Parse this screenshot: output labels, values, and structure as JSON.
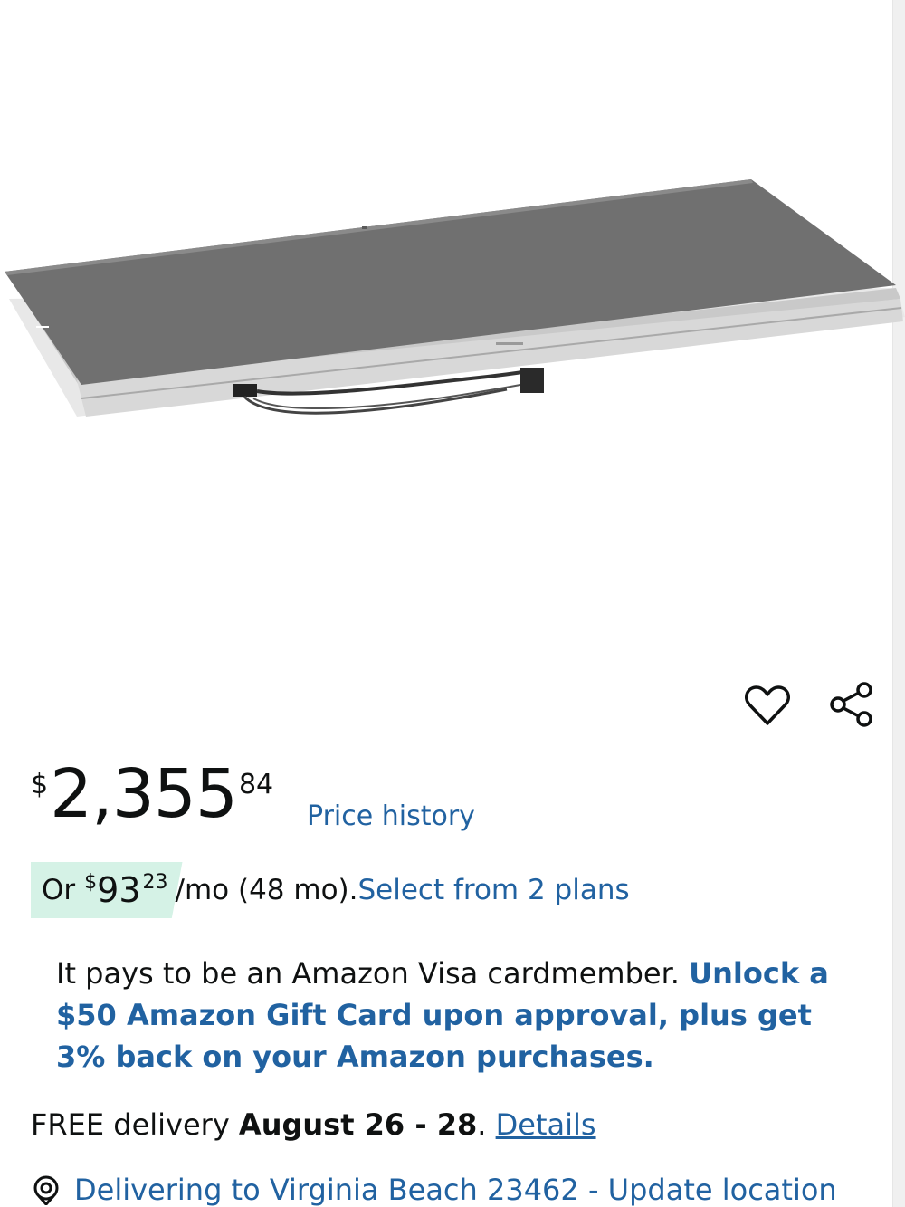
{
  "product": {
    "image_alt": "solar panel"
  },
  "actions": {
    "wishlist_icon": "heart-icon",
    "share_icon": "share-icon"
  },
  "price": {
    "symbol": "$",
    "whole": "2,355",
    "fraction": "84",
    "history_label": "Price history"
  },
  "installment": {
    "prefix": "Or",
    "symbol": "$",
    "whole": "93",
    "fraction": "23",
    "suffix": "/mo (48 mo).",
    "link_label": "Select from 2 plans",
    "highlight_color": "#d5f2e6"
  },
  "visa_promo": {
    "text": "It pays to be an Amazon Visa cardmember. ",
    "link": "Unlock a $50 Amazon Gift Card upon approval, plus get 3% back on your Amazon purchases."
  },
  "delivery": {
    "prefix": "FREE delivery ",
    "date": "August 26 - 28",
    "separator": ". ",
    "details_label": "Details"
  },
  "location": {
    "icon": "location-pin-icon",
    "label": "Delivering to Virginia Beach 23462 - Update location"
  },
  "colors": {
    "link": "#2162a1",
    "text": "#0f1111"
  }
}
